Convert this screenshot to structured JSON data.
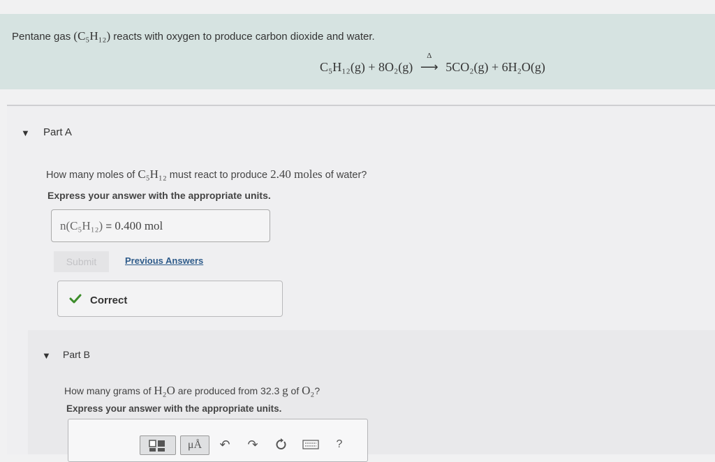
{
  "intro": {
    "text_before": "Pentane gas ",
    "formula": "(C₅H₁₂)",
    "text_after": " reacts with oxygen to produce carbon dioxide and water.",
    "equation_lhs": "C₅H₁₂(g) + 8O₂(g)",
    "equation_delta": "Δ",
    "equation_arrow": "⟶",
    "equation_rhs": "5CO₂(g) + 6H₂O(g)"
  },
  "partA": {
    "title": "Part A",
    "question_pre": "How many moles of ",
    "question_formula": "C₅H₁₂",
    "question_mid": " must react to produce ",
    "question_value": "2.40 moles",
    "question_post": " of water?",
    "instruction": "Express your answer with the appropriate units.",
    "answer_lhs": "n(C₅H₁₂)",
    "answer_eq": " = ",
    "answer_value": "0.400 mol",
    "submit_label": "Submit",
    "previous_label": "Previous Answers",
    "feedback": "Correct"
  },
  "partB": {
    "title": "Part B",
    "question_pre": "How many grams of ",
    "question_formula": "H₂O",
    "question_mid": " are produced from 32.3 ",
    "question_unit": "g",
    "question_of": " of ",
    "question_formula2": "O₂",
    "question_post": "?",
    "instruction": "Express your answer with the appropriate units.",
    "tools": {
      "units_label": "μÅ",
      "help_label": "?"
    }
  },
  "colors": {
    "intro_bg": "#d6e3e1",
    "correct_check": "#3c8c2a",
    "link": "#2e5b8a"
  }
}
